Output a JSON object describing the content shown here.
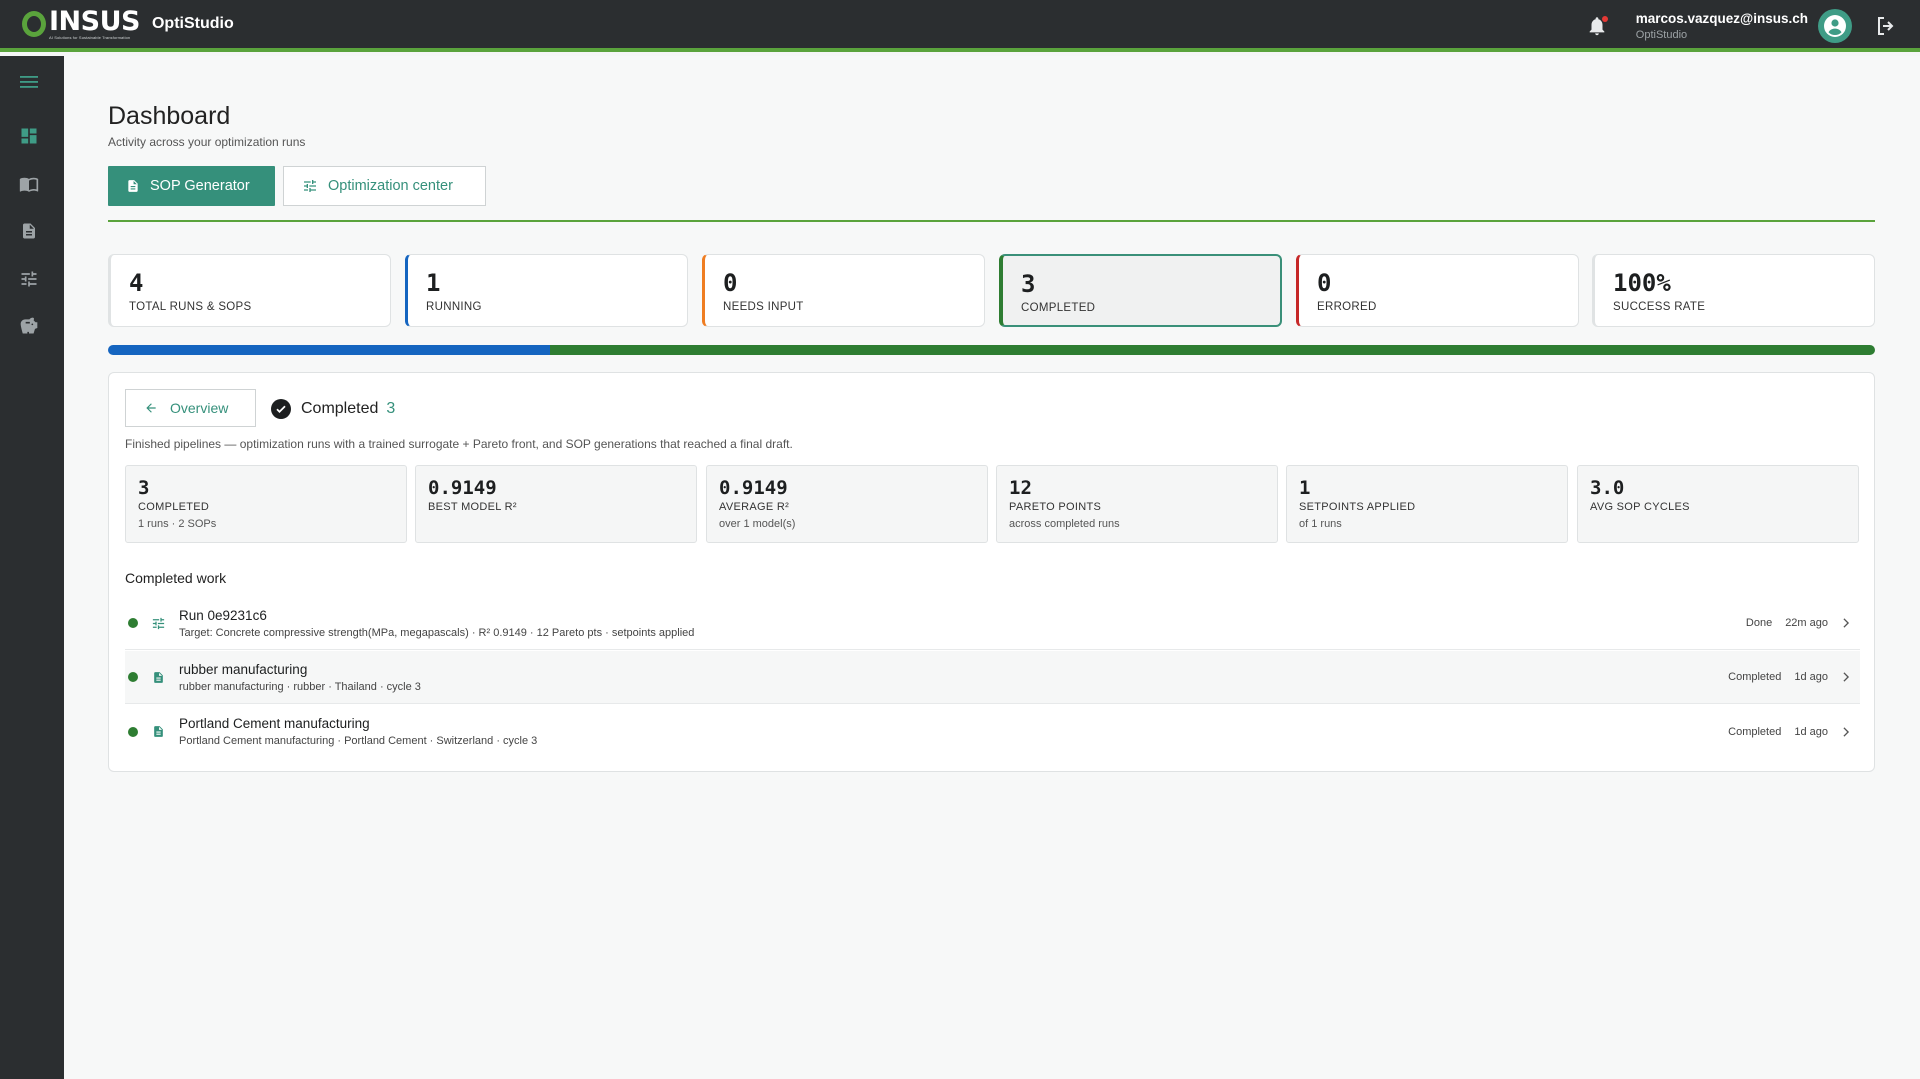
{
  "header": {
    "logo_text": "INSUS",
    "logo_tagline": "AI Solutions for Sustainable Transformation",
    "app_name": "OptiStudio",
    "user_email": "marcos.vazquez@insus.ch",
    "user_app": "OptiStudio"
  },
  "page": {
    "title": "Dashboard",
    "subtitle": "Activity across your optimization runs",
    "primary_button": "SOP Generator",
    "secondary_button": "Optimization center"
  },
  "stats": [
    {
      "value": "4",
      "label": "TOTAL RUNS & SOPS",
      "accent": "#e0e3e4"
    },
    {
      "value": "1",
      "label": "RUNNING",
      "accent": "#1565c0"
    },
    {
      "value": "0",
      "label": "NEEDS INPUT",
      "accent": "#ef7d22"
    },
    {
      "value": "3",
      "label": "COMPLETED",
      "accent": "#2e7d32"
    },
    {
      "value": "0",
      "label": "ERRORED",
      "accent": "#c62828"
    },
    {
      "value": "100%",
      "label": "SUCCESS RATE",
      "accent": "#e0e3e4"
    }
  ],
  "progress": {
    "running_fraction": 0.25,
    "completed_fraction": 0.75,
    "running_color": "#1565c0",
    "completed_color": "#2e7d32"
  },
  "panel": {
    "back_label": "Overview",
    "heading": "Completed",
    "heading_count": "3",
    "description": "Finished pipelines — optimization runs with a trained surrogate + Pareto front, and SOP generations that reached a final draft.",
    "metrics": [
      {
        "value": "3",
        "label": "COMPLETED",
        "sub": "1 runs · 2 SOPs"
      },
      {
        "value": "0.9149",
        "label": "BEST MODEL R²",
        "sub": ""
      },
      {
        "value": "0.9149",
        "label": "AVERAGE R²",
        "sub": "over 1 model(s)"
      },
      {
        "value": "12",
        "label": "PARETO POINTS",
        "sub": "across completed runs"
      },
      {
        "value": "1",
        "label": "SETPOINTS APPLIED",
        "sub": "of 1 runs"
      },
      {
        "value": "3.0",
        "label": "AVG SOP CYCLES",
        "sub": ""
      }
    ],
    "section_title": "Completed work",
    "rows": [
      {
        "icon": "sliders-icon",
        "title": "Run 0e9231c6",
        "desc": "Target: Concrete compressive strength(MPa, megapascals) · R² 0.9149 · 12 Pareto pts · setpoints applied",
        "status": "Done",
        "age": "22m ago"
      },
      {
        "icon": "document-icon",
        "title": "rubber manufacturing",
        "desc": "rubber manufacturing · rubber · Thailand · cycle 3",
        "status": "Completed",
        "age": "1d ago"
      },
      {
        "icon": "document-icon",
        "title": "Portland Cement manufacturing",
        "desc": "Portland Cement manufacturing · Portland Cement · Switzerland · cycle 3",
        "status": "Completed",
        "age": "1d ago"
      }
    ]
  }
}
